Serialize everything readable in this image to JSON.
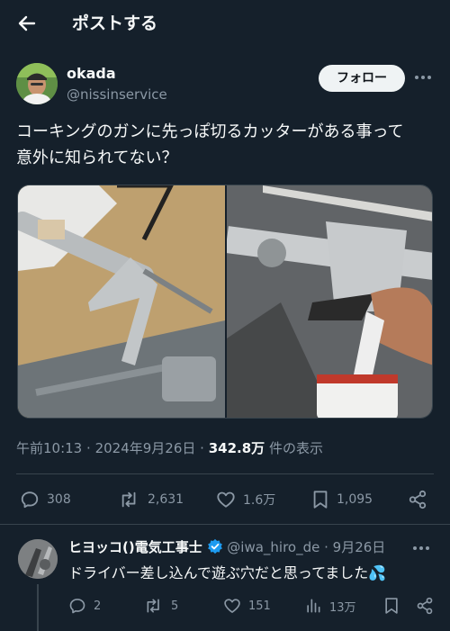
{
  "header": {
    "title": "ポストする"
  },
  "post": {
    "author_name": "okada",
    "author_handle": "@nissinservice",
    "follow_label": "フォロー",
    "text_line1": "コーキングのガンに先っぽ切るカッターがある事って",
    "text_line2": "意外に知られてない？",
    "time": "午前10:13",
    "date": "2024年9月26日",
    "views_count": "342.8万",
    "views_label": "件の表示",
    "separator": "·",
    "stats": {
      "replies": "308",
      "reposts": "2,631",
      "likes": "1.6万",
      "bookmarks": "1,095"
    }
  },
  "reply": {
    "author_name": "ヒヨッコ()電気工事士",
    "author_handle": "@iwa_hiro_de",
    "date": "· 9月26日",
    "text": "ドライバー差し込んで遊ぶ穴だと思ってました",
    "emoji": "💦",
    "stats": {
      "replies": "2",
      "reposts": "5",
      "likes": "151",
      "views": "13万"
    }
  },
  "colors": {
    "background": "#15202b",
    "text": "#f7f9f9",
    "muted": "#8b98a5",
    "verified": "#1d9bf0",
    "divider": "#38444d"
  }
}
